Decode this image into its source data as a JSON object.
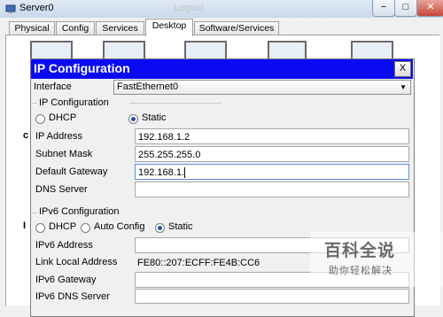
{
  "window": {
    "title": "Server0",
    "background_text": "Logout",
    "minimize_symbol": "−",
    "maximize_symbol": "□",
    "close_symbol": "✕"
  },
  "tabs": [
    {
      "label": "Physical"
    },
    {
      "label": "Config"
    },
    {
      "label": "Services"
    },
    {
      "label": "Desktop",
      "active": true
    },
    {
      "label": "Software/Services"
    }
  ],
  "dialog": {
    "title": "IP Configuration",
    "close_label": "X",
    "interface_label": "Interface",
    "interface_value": "FastEthernet0",
    "ipv4": {
      "section_title": "IP Configuration",
      "dhcp_label": "DHCP",
      "static_label": "Static",
      "mode": "Static",
      "ip_address_label": "IP Address",
      "ip_address": "192.168.1.2",
      "subnet_mask_label": "Subnet Mask",
      "subnet_mask": "255.255.255.0",
      "default_gateway_label": "Default Gateway",
      "default_gateway": "192.168.1.",
      "dns_server_label": "DNS Server",
      "dns_server": ""
    },
    "ipv6": {
      "section_title": "IPv6 Configuration",
      "dhcp_label": "DHCP",
      "auto_config_label": "Auto Config",
      "static_label": "Static",
      "mode": "Static",
      "ipv6_address_label": "IPv6 Address",
      "ipv6_address": "",
      "link_local_label": "Link Local Address",
      "link_local": "FE80::207:ECFF:FE4B:CC6",
      "ipv6_gateway_label": "IPv6 Gateway",
      "ipv6_gateway": "",
      "ipv6_dns_label": "IPv6 DNS Server",
      "ipv6_dns": ""
    }
  },
  "side_labels": {
    "c": "c",
    "i": "I"
  },
  "watermark": {
    "main": "百科全说",
    "sub": "助你轻松解决"
  },
  "colors": {
    "dialog_header": "#0a0af2",
    "active_radio": "#2a4fa6"
  }
}
